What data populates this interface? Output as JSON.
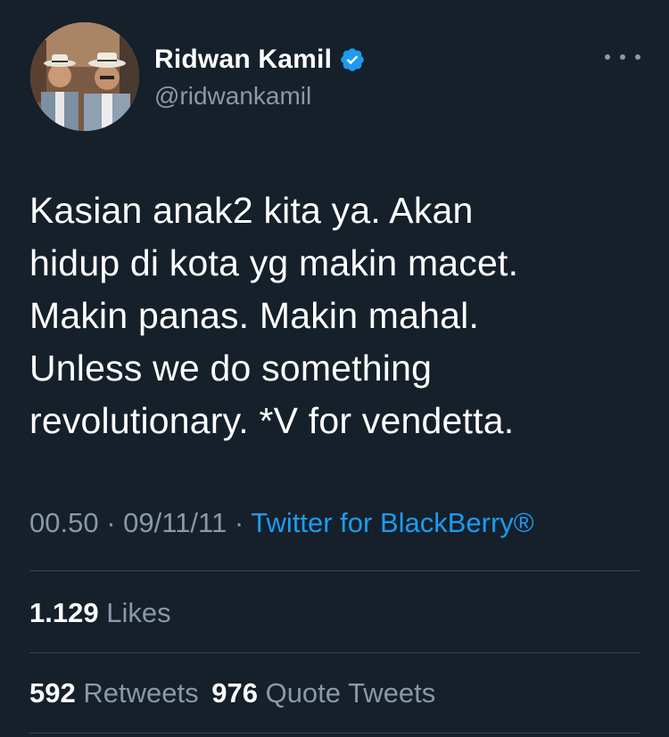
{
  "author": {
    "display_name": "Ridwan Kamil",
    "handle": "@ridwankamil",
    "verified_icon": "verified-badge-icon",
    "avatar_icon": "profile-photo"
  },
  "more_icon": "more-options-icon",
  "tweet": {
    "lines": [
      "Kasian anak2 kita ya. Akan",
      "hidup di kota yg makin macet.",
      "Makin panas. Makin mahal.",
      "Unless we do something",
      "revolutionary. *V for vendetta."
    ]
  },
  "meta": {
    "time": "00.50",
    "separator": "·",
    "date": "09/11/11",
    "source": "Twitter for BlackBerry®"
  },
  "stats": {
    "likes_count": "1.129",
    "likes_label": "Likes",
    "retweets_count": "592",
    "retweets_label": "Retweets",
    "quotes_count": "976",
    "quotes_label": "Quote Tweets"
  },
  "colors": {
    "background": "#15202b",
    "primary_text": "#ffffff",
    "secondary_text": "#8b98a5",
    "link": "#1d9bf0",
    "divider": "#38444d",
    "verified": "#1d9bf0"
  }
}
